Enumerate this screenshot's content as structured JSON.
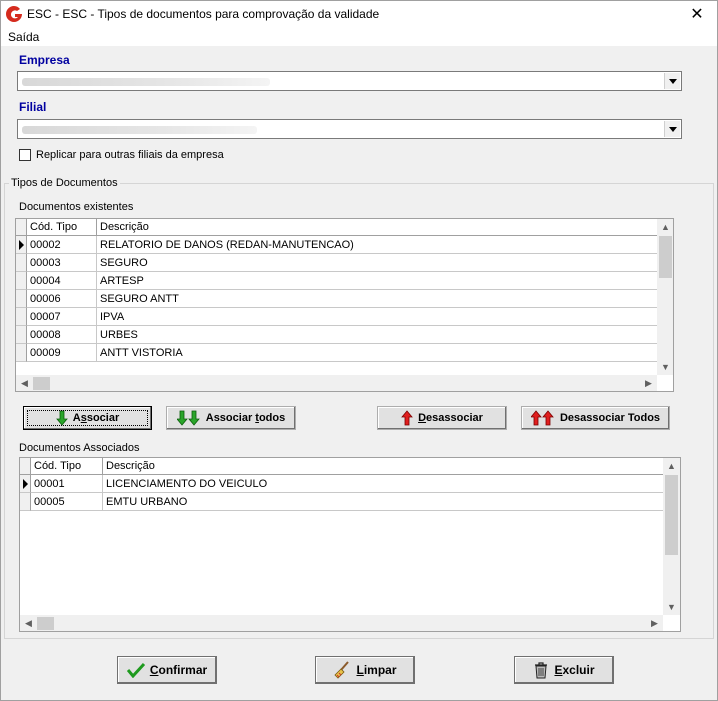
{
  "window": {
    "title": "ESC - ESC - Tipos de documentos para comprovação da validade",
    "close_glyph": "✕"
  },
  "menu": {
    "items": [
      {
        "label": "Saída"
      }
    ]
  },
  "empresa": {
    "label": "Empresa"
  },
  "filial": {
    "label": "Filial"
  },
  "replicar": {
    "label": "Replicar para outras filiais da empresa",
    "checked": false
  },
  "tipos_group": {
    "title": "Tipos de Documentos"
  },
  "existentes": {
    "label": "Documentos existentes",
    "columns": [
      "Cód. Tipo",
      "Descrição"
    ],
    "rows": [
      {
        "cod": "00002",
        "desc": "RELATORIO DE DANOS (REDAN-MANUTENCAO)"
      },
      {
        "cod": "00003",
        "desc": "SEGURO"
      },
      {
        "cod": "00004",
        "desc": "ARTESP"
      },
      {
        "cod": "00006",
        "desc": "SEGURO ANTT"
      },
      {
        "cod": "00007",
        "desc": "IPVA"
      },
      {
        "cod": "00008",
        "desc": "URBES"
      },
      {
        "cod": "00009",
        "desc": "ANTT VISTORIA"
      }
    ]
  },
  "buttons": {
    "associar": {
      "label_pre": "A",
      "label_ul": "s",
      "label_post": "sociar",
      "icon": "green-down-arrow-icon"
    },
    "associar_todos": {
      "label_pre": "Associar ",
      "label_ul": "t",
      "label_post": "odos",
      "icon": "double-green-down-arrow-icon"
    },
    "desassociar": {
      "label_pre": "",
      "label_ul": "D",
      "label_post": "esassociar",
      "icon": "red-up-arrow-icon"
    },
    "desassociar_todos": {
      "label_pre": "Desassociar Todos",
      "label_ul": "",
      "label_post": "",
      "icon": "double-red-up-arrow-icon"
    }
  },
  "associados": {
    "label": "Documentos Associados",
    "columns": [
      "Cód. Tipo",
      "Descrição"
    ],
    "rows": [
      {
        "cod": "00001",
        "desc": "LICENCIAMENTO DO VEICULO"
      },
      {
        "cod": "00005",
        "desc": "EMTU URBANO"
      }
    ]
  },
  "footer": {
    "confirmar": {
      "label_ul": "C",
      "label_post": "onfirmar",
      "icon": "green-check-icon"
    },
    "limpar": {
      "label_ul": "L",
      "label_post": "impar",
      "icon": "broom-icon"
    },
    "excluir": {
      "label_ul": "E",
      "label_post": "xcluir",
      "icon": "trash-icon"
    }
  },
  "colors": {
    "label_blue": "#0000a0",
    "brand_red": "#d52b1e"
  }
}
